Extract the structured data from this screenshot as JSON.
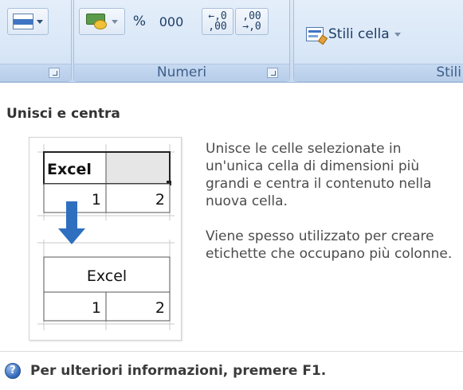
{
  "ribbon": {
    "groups": [
      {
        "label": ""
      },
      {
        "label": "Numeri"
      },
      {
        "label": "Stili"
      }
    ],
    "numeri": {
      "percent": "%",
      "thousands": "000",
      "decimal_increase_top": "←,0",
      "decimal_increase_bottom": ",00",
      "decimal_decrease_top": ",00",
      "decimal_decrease_bottom": "→,0"
    },
    "stili": {
      "cell_styles_label": "Stili cella"
    },
    "icons": [
      "merge-center-icon",
      "currency-icon",
      "cell-styles-icon",
      "dialog-launcher-icon"
    ]
  },
  "tooltip": {
    "title": "Unisci e centra",
    "description": [
      "Unisce le celle selezionate in un'unica cella di dimensioni più grandi e centra il contenuto nella nuova cella.",
      "Viene spesso utilizzato per creare etichette che occupano più colonne."
    ],
    "preview": {
      "before": {
        "cell_a1": "Excel",
        "cell_a2": "1",
        "cell_b2": "2"
      },
      "after": {
        "merged": "Excel",
        "cell_a2": "1",
        "cell_b2": "2"
      },
      "arrow_color": "#2f6fbf"
    },
    "help_text": "Per ulteriori informazioni, premere F1."
  }
}
